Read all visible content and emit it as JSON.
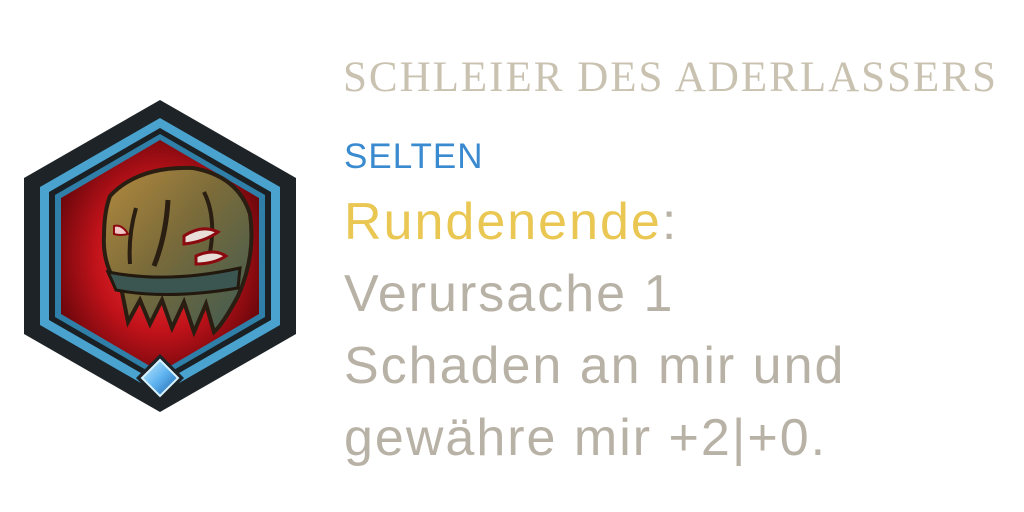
{
  "item": {
    "name": "SCHLEIER DES ADERLASSERS",
    "rarity": "SELTEN",
    "icon": "veil-mask-icon",
    "effect": {
      "keyword": "Rundenende",
      "separator": ":",
      "lines": [
        "Verursache 1",
        "Schaden an mir und",
        "gewähre mir +2|+0."
      ]
    }
  },
  "colors": {
    "title": "#c9c2b0",
    "rarity": "#3a8ad0",
    "keyword": "#e9c752",
    "body": "#b8b2a6",
    "frame_outer": "#1d2326",
    "frame_blue": "#4aa3cf",
    "background_red": "#c0121a",
    "gem": "#5fb4f0"
  }
}
